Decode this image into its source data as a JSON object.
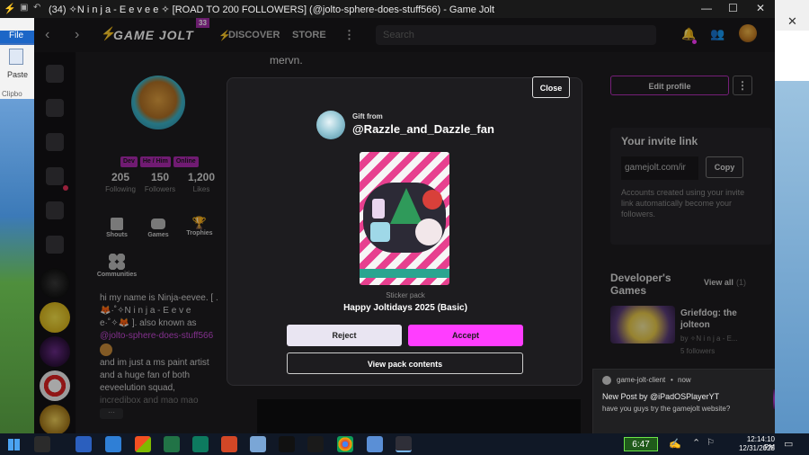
{
  "window": {
    "title": "(34) ✧N i n j a - E e v e e ✧ [ROAD TO 200 FOLLOWERS] (@jolto-sphere-does-stuff566) - Game Jolt",
    "minimize": "—",
    "maximize": "☐",
    "close": "✕"
  },
  "desktop": {
    "file_menu": "File",
    "paste_label": "Paste",
    "clipboard_label": "Clipbo",
    "right_close": "✕"
  },
  "nav": {
    "back": "‹",
    "forward": "›",
    "logo": "GAME JOLT",
    "logo_badge": "33",
    "discover": "DISCOVER",
    "store": "STORE",
    "more": "⋮",
    "search_placeholder": "Search"
  },
  "profile": {
    "tags": [
      "Dev",
      "He / Him",
      "Online"
    ],
    "following_count": "205",
    "following_label": "Following",
    "followers_count": "150",
    "followers_label": "Followers",
    "likes_count": "1,200",
    "likes_label": "Likes",
    "nav_shouts": "Shouts",
    "nav_games": "Games",
    "nav_trophies": "Trophies",
    "nav_communities": "Communities",
    "bio_line1": "hi my name is Ninja-eevee. [ .",
    "bio_line2": "🦊·˚✧N i n j a - E e v e",
    "bio_line3": "e·˚✧🦊 ]. also known as",
    "bio_mention": "@jolto-sphere-does-stuff566",
    "bio_line4": "and im just a ms paint artist",
    "bio_line5": "and a huge fan of both",
    "bio_line6": "eeveelution squad,",
    "bio_line7": "incredibox and mao mao",
    "bio_more": "···"
  },
  "center": {
    "post_text": "mervn."
  },
  "right": {
    "edit_profile": "Edit profile",
    "more": "⋮",
    "invite_title": "Your invite link",
    "invite_link": "gamejolt.com/ir",
    "copy": "Copy",
    "invite_desc": "Accounts created using your invite link automatically become your followers.",
    "dev_games_title": "Developer's Games",
    "view_all": "View all",
    "view_all_count": "(1)",
    "game_title": "Griefdog: the jolteon",
    "game_by": "by ✧N i n j a - E...",
    "game_followers": "5 followers"
  },
  "modal": {
    "close": "Close",
    "gift_from": "Gift from",
    "sender": "@Razzle_and_Dazzle_fan",
    "pack_type": "Sticker pack",
    "pack_name": "Happy Joltidays 2025 (Basic)",
    "reject": "Reject",
    "accept": "Accept",
    "view_contents": "View pack contents"
  },
  "toast": {
    "source": "game-jolt-client",
    "time": "now",
    "dot": "•",
    "title": "New Post by @iPadOSPlayerYT",
    "body": "have you guys try the gamejolt website?",
    "close": "✕"
  },
  "taskbar": {
    "battery": "6:47",
    "time": "12:14:10 PM",
    "date": "12/31/2025"
  },
  "colors": {
    "accent_pink": "#ff3dff",
    "accent_green": "#6ce548",
    "modal_bg": "#1d1c1f",
    "reject_bg": "#e9e5f2"
  }
}
